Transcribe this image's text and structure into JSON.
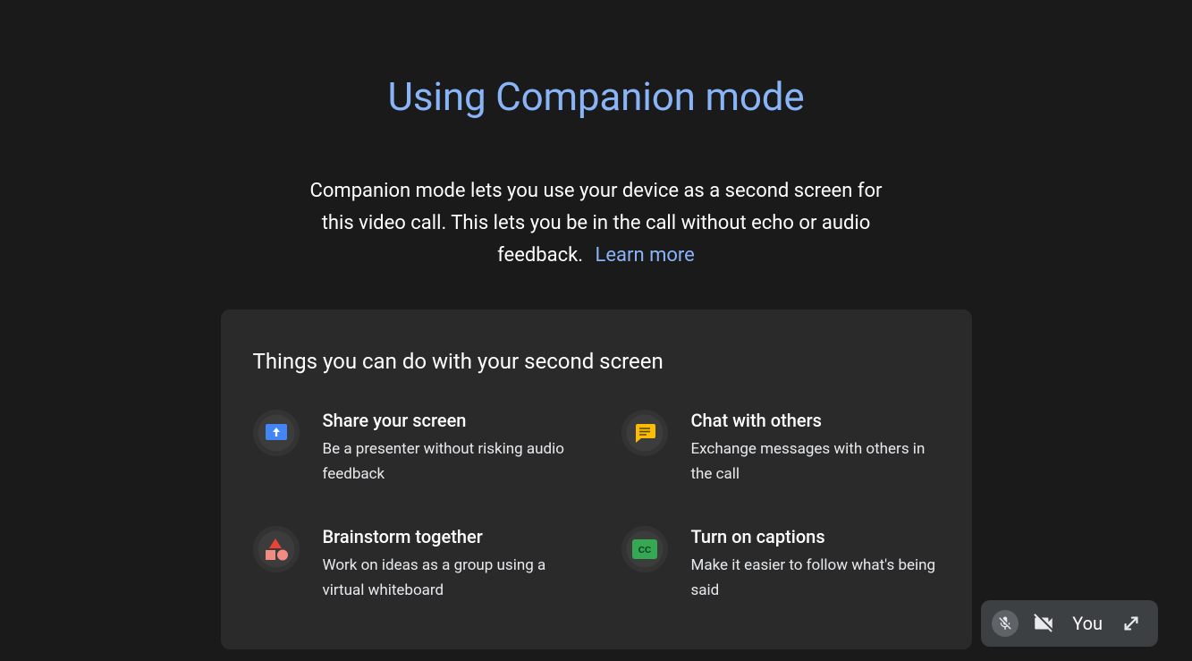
{
  "page": {
    "title": "Using Companion mode",
    "subtitle": "Companion mode lets you use your device as a second screen for this video call. This lets you be in the call without echo or audio feedback.",
    "learn_more": "Learn more"
  },
  "card": {
    "title": "Things you can do with your second screen",
    "features": [
      {
        "title": "Share your screen",
        "desc": "Be a presenter without risking audio feedback"
      },
      {
        "title": "Chat with others",
        "desc": "Exchange messages with others in the call"
      },
      {
        "title": "Brainstorm together",
        "desc": "Work on ideas as a group using a virtual whiteboard"
      },
      {
        "title": "Turn on captions",
        "desc": "Make it easier to follow what's being said"
      }
    ]
  },
  "self_view": {
    "label": "You"
  }
}
